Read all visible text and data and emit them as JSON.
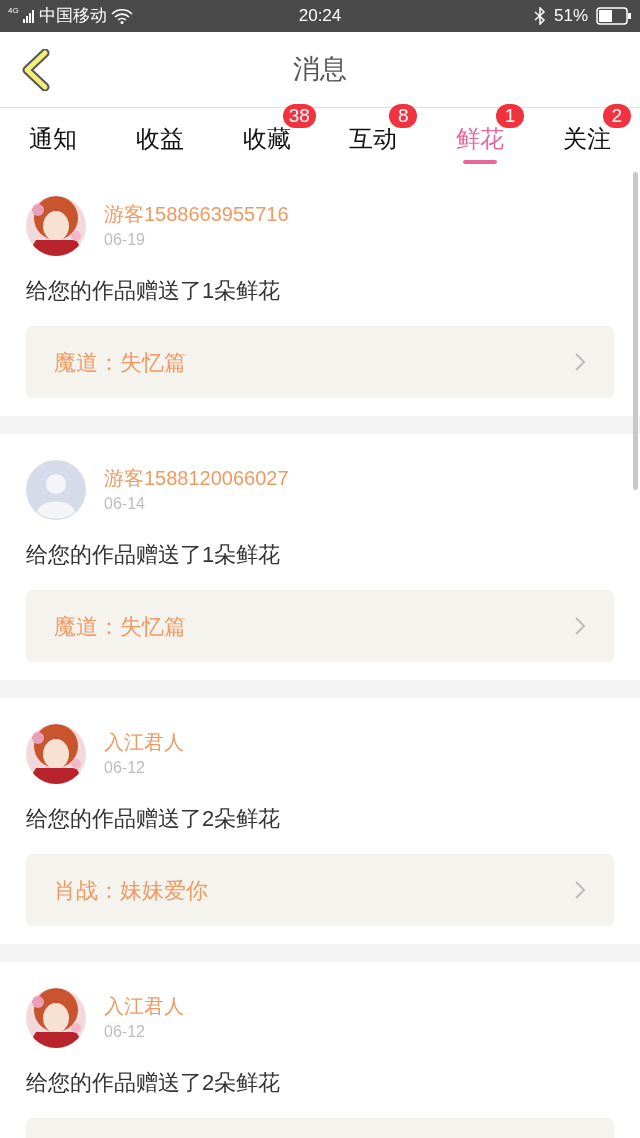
{
  "status_bar": {
    "network": "4G",
    "carrier": "中国移动",
    "time": "20:24",
    "battery": "51%"
  },
  "header": {
    "title": "消息"
  },
  "tabs": [
    {
      "label": "通知",
      "selected": false
    },
    {
      "label": "收益",
      "selected": false
    },
    {
      "label": "收藏",
      "selected": false,
      "badge": "38"
    },
    {
      "label": "互动",
      "selected": false,
      "badge": "8"
    },
    {
      "label": "鲜花",
      "selected": true,
      "badge": "1"
    },
    {
      "label": "关注",
      "selected": false,
      "badge": "2"
    }
  ],
  "messages": [
    {
      "kind": "picture",
      "user": "游客1588663955716",
      "date": "06-19",
      "text": "给您的作品赠送了1朵鲜花",
      "work": "魔道：失忆篇"
    },
    {
      "kind": "default",
      "user": "游客1588120066027",
      "date": "06-14",
      "text": "给您的作品赠送了1朵鲜花",
      "work": "魔道：失忆篇"
    },
    {
      "kind": "picture",
      "user": "入江君人",
      "date": "06-12",
      "text": "给您的作品赠送了2朵鲜花",
      "work": "肖战：妹妹爱你"
    },
    {
      "kind": "picture",
      "user": "入江君人",
      "date": "06-12",
      "text": "给您的作品赠送了2朵鲜花"
    }
  ]
}
